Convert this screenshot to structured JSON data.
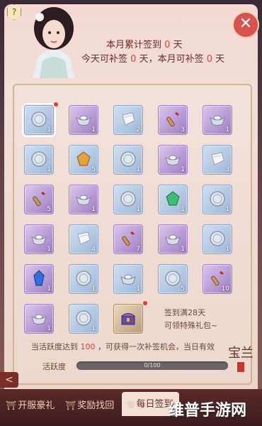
{
  "header": {
    "help_label": "?",
    "line1_prefix": "本月累计签到",
    "line1_value": "0",
    "line1_suffix": "天",
    "line2_a_prefix": "今天可补签",
    "line2_a_value": "0",
    "line2_a_suffix": "天，本月可补签",
    "line2_b_value": "0",
    "line2_b_suffix": "天",
    "close_label": "✕"
  },
  "rewards": [
    {
      "type": "coin",
      "bg": "blue",
      "qty": "1",
      "selected": true,
      "dot": true
    },
    {
      "type": "ingot",
      "bg": "purple",
      "qty": "1",
      "dot": false
    },
    {
      "type": "cloth",
      "bg": "blue",
      "qty": "2",
      "dot": false
    },
    {
      "type": "scroll",
      "bg": "purple",
      "qty": "3",
      "dot": false
    },
    {
      "type": "ingot",
      "bg": "purple",
      "qty": "1",
      "dot": false
    },
    {
      "type": "coin",
      "bg": "blue",
      "qty": "1",
      "dot": false
    },
    {
      "type": "gem-gold",
      "bg": "blue",
      "qty": "5",
      "dot": false
    },
    {
      "type": "coin",
      "bg": "blue",
      "qty": "1",
      "dot": false
    },
    {
      "type": "ingot",
      "bg": "purple",
      "qty": "1",
      "dot": false
    },
    {
      "type": "cloth",
      "bg": "blue",
      "qty": "3",
      "dot": false
    },
    {
      "type": "scroll",
      "bg": "purple",
      "qty": "5",
      "dot": false
    },
    {
      "type": "ingot",
      "bg": "purple",
      "qty": "1",
      "dot": false
    },
    {
      "type": "coin",
      "bg": "blue",
      "qty": "1",
      "dot": false
    },
    {
      "type": "gem-green",
      "bg": "blue",
      "qty": "1",
      "dot": false
    },
    {
      "type": "coin",
      "bg": "blue",
      "qty": "1",
      "dot": false
    },
    {
      "type": "ingot",
      "bg": "purple",
      "qty": "1",
      "dot": false
    },
    {
      "type": "cloth",
      "bg": "blue",
      "qty": "4",
      "dot": false
    },
    {
      "type": "scroll",
      "bg": "purple",
      "qty": "7",
      "dot": false
    },
    {
      "type": "ingot",
      "bg": "purple",
      "qty": "1",
      "dot": false
    },
    {
      "type": "coin",
      "bg": "blue",
      "qty": "1",
      "dot": false
    },
    {
      "type": "gem-blue",
      "bg": "purple",
      "qty": "1",
      "dot": false
    },
    {
      "type": "coin",
      "bg": "blue",
      "qty": "1",
      "dot": false
    },
    {
      "type": "ingot",
      "bg": "blue",
      "qty": "1",
      "dot": false
    },
    {
      "type": "coin",
      "bg": "blue",
      "qty": "5",
      "dot": false
    },
    {
      "type": "scroll",
      "bg": "purple",
      "qty": "10",
      "dot": false
    },
    {
      "type": "ingot",
      "bg": "purple",
      "qty": "1",
      "dot": false
    },
    {
      "type": "coin",
      "bg": "blue",
      "qty": "1",
      "dot": false
    },
    {
      "type": "chest",
      "bg": "chest",
      "qty": "",
      "dot": true
    }
  ],
  "bonus_note": {
    "line1": "签到满28天",
    "line2": "可领特殊礼包~"
  },
  "activity": {
    "note_prefix": "当活跃度达到",
    "note_value": "100",
    "note_suffix": "，可获得一次补签机会，当日有效",
    "label": "活跃度",
    "progress_text": "0/100",
    "progress_fraction": 0
  },
  "seal_text": "宝兰",
  "side_arrow": "<",
  "tabs": [
    {
      "label": "开服豪礼",
      "icon": "gift-icon",
      "active": false
    },
    {
      "label": "奖励找回",
      "icon": "gift-icon",
      "active": false
    },
    {
      "label": "每日签到",
      "icon": "calendar-icon",
      "active": true
    }
  ],
  "watermark": "维普手游网",
  "colors": {
    "accent_red": "#e4463a",
    "progress_fill": "#c8945e",
    "tab_bg": "#3b1c1e"
  }
}
